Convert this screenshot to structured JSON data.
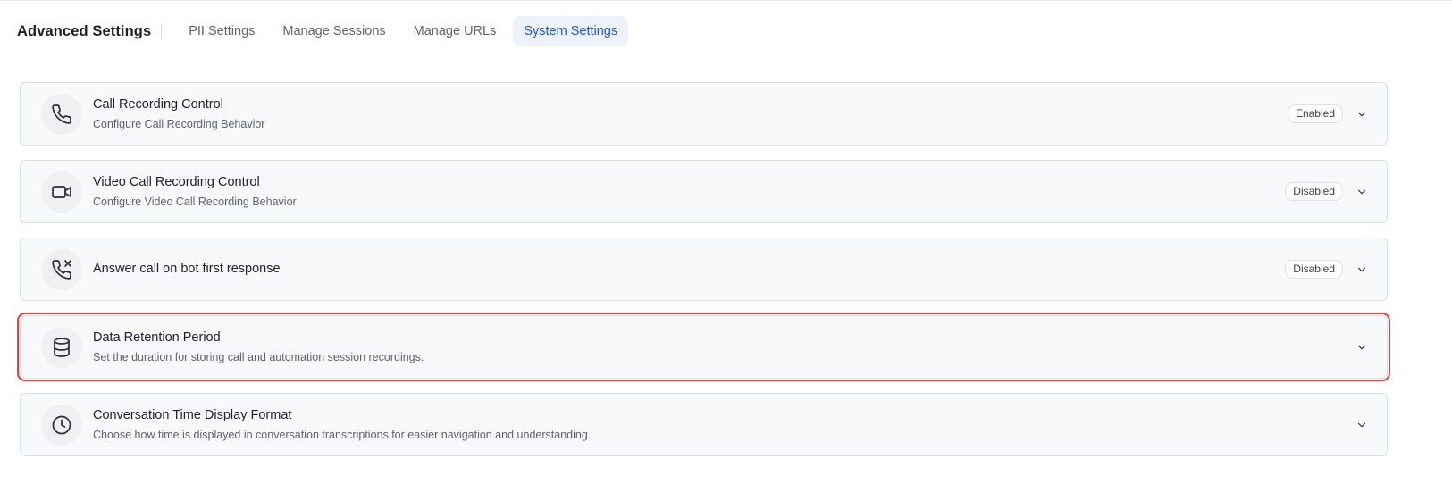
{
  "header": {
    "title": "Advanced Settings",
    "tabs": [
      {
        "label": "PII Settings",
        "active": false
      },
      {
        "label": "Manage Sessions",
        "active": false
      },
      {
        "label": "Manage URLs",
        "active": false
      },
      {
        "label": "System Settings",
        "active": true
      }
    ]
  },
  "settings": [
    {
      "icon": "phone-icon",
      "title": "Call Recording Control",
      "description": "Configure Call Recording Behavior",
      "status": "Enabled"
    },
    {
      "icon": "video-camera-icon",
      "title": "Video Call Recording Control",
      "description": "Configure Video Call Recording Behavior",
      "status": "Disabled"
    },
    {
      "icon": "phone-missed-icon",
      "title": "Answer call on bot first response",
      "description": "",
      "status": "Disabled"
    },
    {
      "icon": "database-icon",
      "title": "Data Retention Period",
      "description": "Set the duration for storing call and automation session recordings.",
      "status": ""
    },
    {
      "icon": "clock-icon",
      "title": "Conversation Time Display Format",
      "description": "Choose how time is displayed in conversation transcriptions for easier navigation and understanding.",
      "status": ""
    }
  ],
  "colors": {
    "accent": "#2a55c7",
    "active_tab_bg": "#eef2fd",
    "highlight_border": "#d64545",
    "card_bg": "#f8f9fa"
  }
}
